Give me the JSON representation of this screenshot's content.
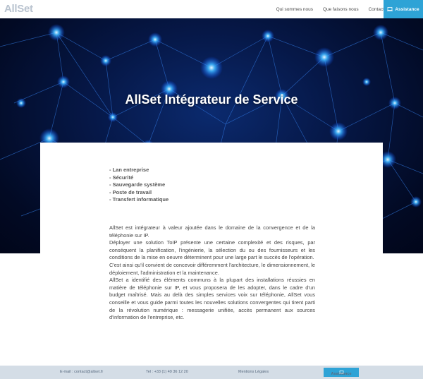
{
  "header": {
    "logo": "AllSet",
    "nav": [
      "Qui sommes nous",
      "Que faisons nous",
      "Contact"
    ],
    "assistance_label": "Assistance"
  },
  "hero": {
    "title": "AllSet Intégrateur de Service"
  },
  "content": {
    "services": [
      "- Lan entreprise",
      "- Sécurité",
      "- Sauvegarde système",
      "- Poste de travail",
      "- Transfert informatique"
    ],
    "paragraphs": [
      "AllSet est intégrateur à valeur ajoutée dans le domaine de la convergence et de la téléphonie sur IP.",
      " Déployer une solution ToIP présente une certaine complexité et des risques, par conséquent la planification, l'ingénierie, la sélection du ou des fournisseurs et les conditions de la mise en oeuvre déterminent pour une large part le succès de l'opération.",
      "C'est ainsi qu'il convient de concevoir différemment l'architecture, le dimensionnement, le déploiement, l'administration et la maintenance.",
      " AllSet a identifié des éléments communs à la plupart des installations réussies en matière de téléphonie sur IP, et vous proposera de les adopter, dans le cadre d'un budget maîtrisé. Mais au delà des simples services voix sur téléphonie, AllSet vous conseille et vous guide parmi toutes les nouvelles solutions convergentes qui tirent parti de la révolution numérique : messagerie unifiée, accès permanent aux sources d'information de l'entreprise, etc."
    ]
  },
  "footer": {
    "email": "E-mail : contact@allset.fr",
    "phone": "Tel : +33 (1) 49 36 12 20",
    "legal": "Mentions Légales",
    "assistance_label": "Assistance"
  },
  "colors": {
    "accent": "#2ea3d6",
    "footer_bg": "#d4dde6",
    "hero_bg": "#061848"
  }
}
